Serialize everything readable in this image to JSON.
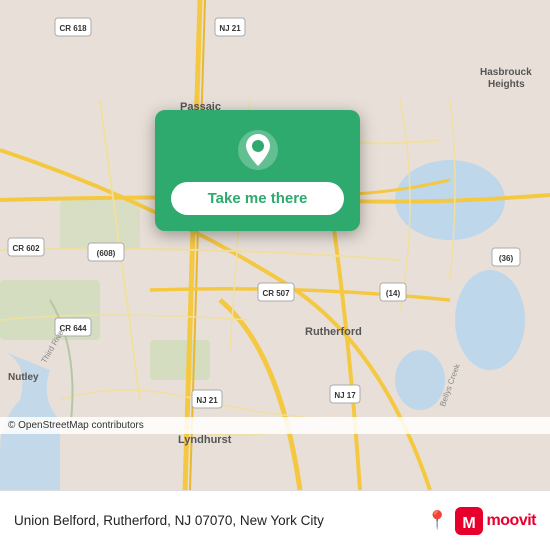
{
  "map": {
    "alt": "Map of Rutherford NJ area",
    "background_color": "#e8e0d8"
  },
  "popup": {
    "button_label": "Take me there",
    "pin_icon": "location-pin"
  },
  "attribution": {
    "text": "© OpenStreetMap contributors"
  },
  "bottom_bar": {
    "location_text": "Union Belford, Rutherford, NJ 07070, New York City",
    "moovit_label": "moovit",
    "moovit_icon": "moovit-logo"
  }
}
